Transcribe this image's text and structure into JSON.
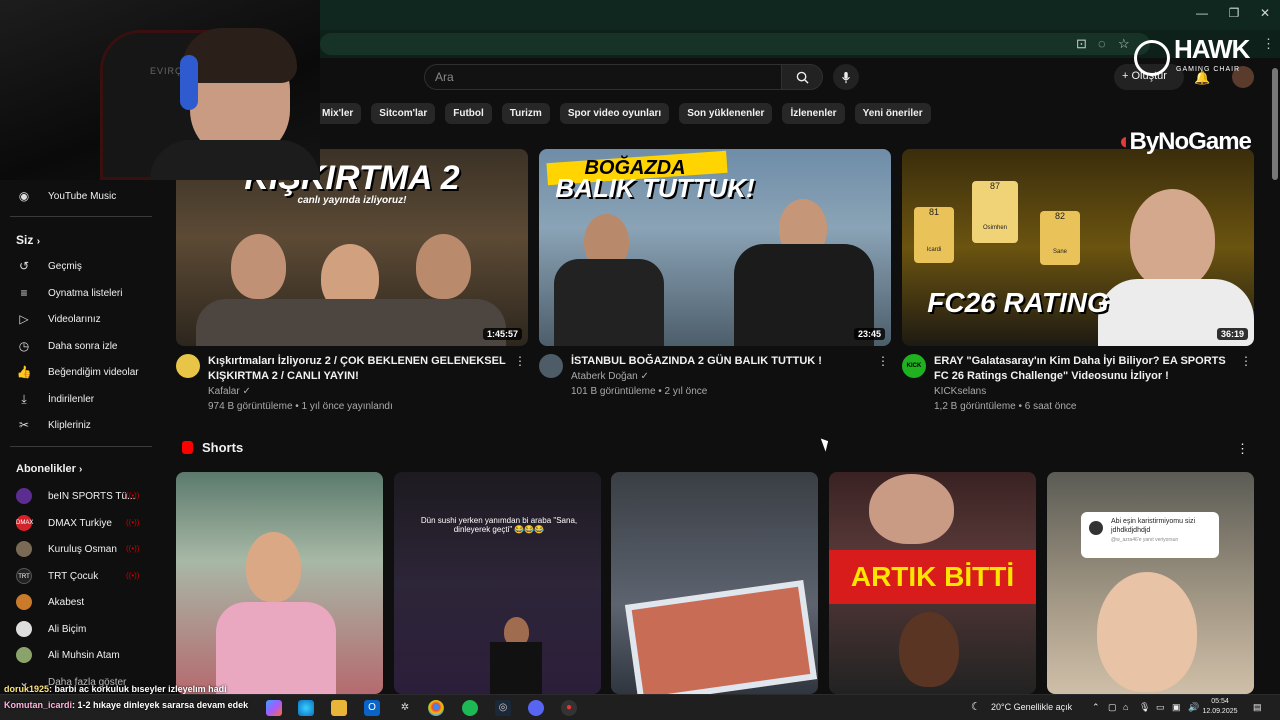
{
  "browser": {
    "window_controls": [
      "—",
      "❐",
      "✕"
    ]
  },
  "header": {
    "search_placeholder": "Ara",
    "create_label": "Oluştur"
  },
  "chips": [
    "Mix'ler",
    "Sitcom'lar",
    "Futbol",
    "Turizm",
    "Spor video oyunları",
    "Son yüklenenler",
    "İzlenenler",
    "Yeni öneriler"
  ],
  "sidebar": {
    "top_item": "YouTube Music",
    "you_heading": "Siz",
    "you_items": [
      "Geçmiş",
      "Oynatma listeleri",
      "Videolarınız",
      "Daha sonra izle",
      "Beğendiğim videolar",
      "İndirilenler",
      "Klipleriniz"
    ],
    "subs_heading": "Abonelikler",
    "subs": [
      "beIN SPORTS Tü...",
      "DMAX Turkiye",
      "Kuruluş Osman",
      "TRT Çocuk",
      "Akabest",
      "Ali Biçim",
      "Ali Muhsin Atam",
      "Daha fazla göster"
    ],
    "sub_avatar_text": [
      "",
      "DMAX",
      "",
      "TRT",
      "",
      "",
      "",
      ""
    ]
  },
  "webcam": {
    "brand": "EVIRÇ"
  },
  "videos": [
    {
      "title": "Kışkırtmaları İzliyoruz 2  / ÇOK BEKLENEN GELENEKSEL KIŞKIRTMA 2 / CANLI YAYIN!",
      "channel": "Kafalar",
      "stats": "974 B görüntüleme • 1 yıl önce yayınlandı",
      "duration": "1:45:57",
      "thumb_text": "KIŞKIRTMA 2",
      "thumb_subtext": "canlı yayında izliyoruz!",
      "verified": true
    },
    {
      "title": "İSTANBUL BOĞAZINDA 2 GÜN BALIK TUTTUK !",
      "channel": "Ataberk Doğan",
      "stats": "101 B görüntüleme • 2 yıl önce",
      "duration": "23:45",
      "thumb_text_1": "BOĞAZDA",
      "thumb_text_2": "BALIK TUTTUK!",
      "verified": true
    },
    {
      "title": "ERAY \"Galatasaray'ın  Kim Daha İyi Biliyor? EA SPORTS FC 26 Ratings Challenge\" Videosunu İzliyor !",
      "channel": "KICKselans",
      "stats": "1,2 B görüntüleme • 6 saat önce",
      "duration": "36:19",
      "thumb_text": "FC26 RATING",
      "card_ratings": [
        "81",
        "87",
        "82"
      ],
      "card_names": [
        "Icardi",
        "Osimhen",
        "Sane"
      ],
      "channel_avatar_text": "KICK",
      "verified": false
    }
  ],
  "shorts": {
    "heading": "Shorts",
    "items": [
      {
        "overlay": ""
      },
      {
        "overlay": "Dün sushi yerken yanımdan bi araba \"Sana, dinleyerek geçti\" 😂😂😂"
      },
      {
        "overlay": ""
      },
      {
        "overlay": "ARTIK BİTTİ"
      },
      {
        "overlay": "Abi eşin karistirmiyomu sizi jdhdkdjdhdjd",
        "overlay_sub": "@w_azra46'e yanıt veriyorsun"
      }
    ]
  },
  "overlays": {
    "hawk_title": "HAWK",
    "hawk_sub": "GAMING CHAIR",
    "bynogame": "ByNoGame",
    "chat": [
      {
        "user": "doruk1925",
        "msg": ": barbi ac korkuluk bıseyler izleyelım hadi"
      },
      {
        "user": "Komutan_icardi",
        "msg": ": 1-2 hıkaye dinleyek sararsa devam edek"
      }
    ]
  },
  "taskbar": {
    "weather": "20°C  Genellikle açık",
    "time": "05:54",
    "date": "12.09.2025"
  },
  "colors": {
    "background": "#0f0f0f",
    "chip": "#272727",
    "youtube_red": "#ff0000",
    "chrome_frame": "#10271f"
  }
}
